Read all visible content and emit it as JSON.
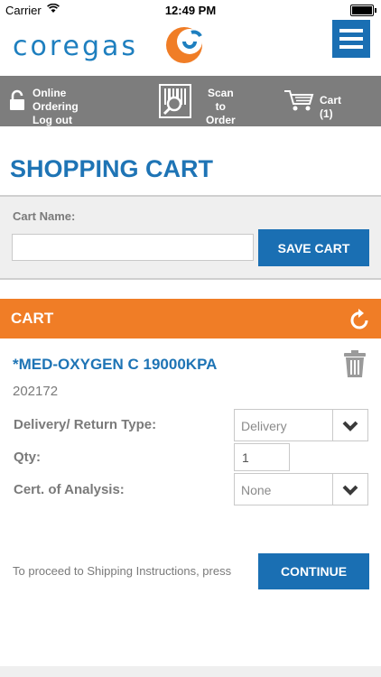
{
  "status_bar": {
    "carrier": "Carrier",
    "time": "12:49 PM"
  },
  "header": {
    "logo_text": "coregas",
    "menu_icon": "hamburger-menu-icon"
  },
  "nav": {
    "online_line1": "Online Ordering",
    "online_line2": "Log out",
    "scan_line1": "Scan to",
    "scan_line2": "Order",
    "cart_label": "Cart (1)"
  },
  "page_title": "SHOPPING CART",
  "cart_name": {
    "label": "Cart Name:",
    "value": "",
    "placeholder": "",
    "save_label": "SAVE CART"
  },
  "cart_section": {
    "title": "CART"
  },
  "item": {
    "name": "*MED-OXYGEN C 19000KPA",
    "code": "202172",
    "delivery_label": "Delivery/ Return Type:",
    "delivery_value": "Delivery",
    "qty_label": "Qty:",
    "qty_value": "1",
    "cert_label": "Cert. of Analysis:",
    "cert_value": "None"
  },
  "footer": {
    "proceed_text": "To proceed to Shipping Instructions, press",
    "continue_label": "CONTINUE"
  },
  "colors": {
    "brand_blue": "#1a6fb3",
    "accent_orange": "#f07d26",
    "nav_gray": "#7d7d7d"
  }
}
